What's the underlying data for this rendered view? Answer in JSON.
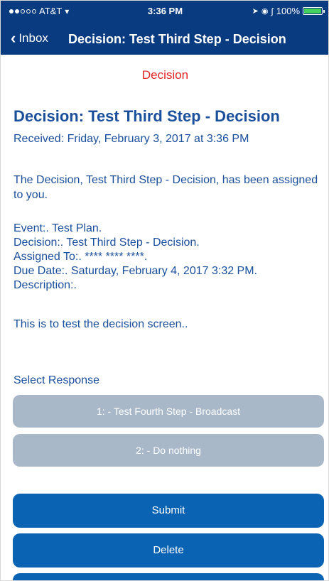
{
  "status_bar": {
    "carrier": "AT&T",
    "time": "3:36 PM",
    "battery": "100%",
    "battery_level": 1.0
  },
  "nav": {
    "back_label": "Inbox",
    "title": "Decision: Test Third Step - Decision"
  },
  "content": {
    "type_label": "Decision",
    "heading": "Decision: Test Third Step - Decision",
    "received": "Received: Friday, February 3, 2017 at 3:36 PM",
    "intro": "The Decision, Test Third Step - Decision, has been assigned to you.",
    "details": [
      "Event:. Test Plan.",
      "Decision:. Test Third Step - Decision.",
      "Assigned To:. **** **** ****.",
      "Due Date:. Saturday, February 4, 2017 3:32 PM.",
      "Description:."
    ],
    "description": "This is to test the decision screen.."
  },
  "response": {
    "label": "Select Response",
    "options": [
      "1:  - Test Fourth Step - Broadcast",
      "2:  - Do nothing"
    ]
  },
  "actions": {
    "submit": "Submit",
    "delete": "Delete"
  },
  "colors": {
    "bar": "#093b80",
    "text": "#1a4f9c",
    "accent_red": "#e02424",
    "button": "#0b63b4",
    "option_disabled": "#a9b8c9"
  }
}
